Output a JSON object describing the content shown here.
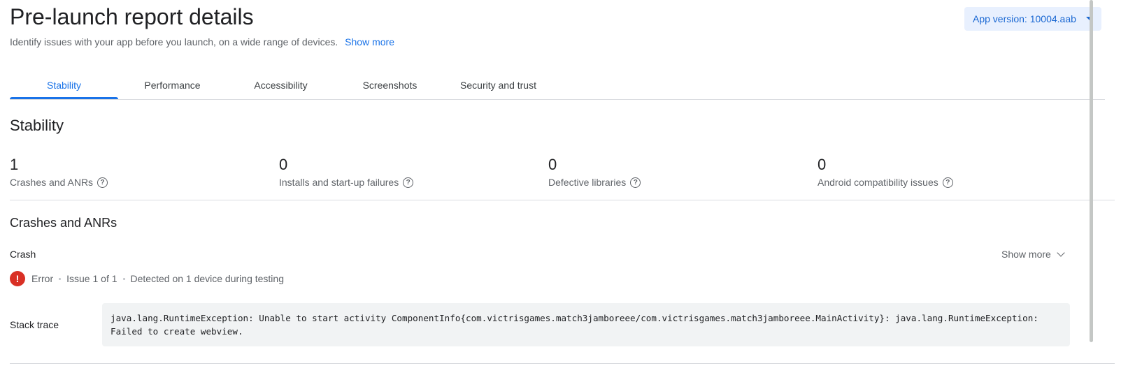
{
  "header": {
    "title": "Pre-launch report details",
    "subtitle": "Identify issues with your app before you launch, on a wide range of devices.",
    "show_more_link": "Show more",
    "version_button": "App version: 10004.aab"
  },
  "tabs": [
    {
      "label": "Stability",
      "active": true
    },
    {
      "label": "Performance",
      "active": false
    },
    {
      "label": "Accessibility",
      "active": false
    },
    {
      "label": "Screenshots",
      "active": false
    },
    {
      "label": "Security and trust",
      "active": false
    }
  ],
  "stability": {
    "title": "Stability",
    "metrics": [
      {
        "value": "1",
        "label": "Crashes and ANRs"
      },
      {
        "value": "0",
        "label": "Installs and start-up failures"
      },
      {
        "value": "0",
        "label": "Defective libraries"
      },
      {
        "value": "0",
        "label": "Android compatibility issues"
      }
    ]
  },
  "crashes": {
    "title": "Crashes and ANRs",
    "crash_label": "Crash",
    "show_more": "Show more",
    "severity": "Error",
    "issue_count": "Issue 1 of 1",
    "detected": "Detected on 1 device during testing",
    "stack_label": "Stack trace",
    "stack_trace": "java.lang.RuntimeException: Unable to start activity ComponentInfo{com.victrisgames.match3jamboreee/com.victrisgames.match3jamboreee.MainActivity}: java.lang.RuntimeException: Failed to create webview."
  },
  "icons": {
    "help": "help-circle-icon",
    "error": "error-icon",
    "chevron": "chevron-down-icon"
  },
  "colors": {
    "accent": "#1a73e8",
    "error": "#d93025",
    "version_bg": "#e8f0fe"
  }
}
